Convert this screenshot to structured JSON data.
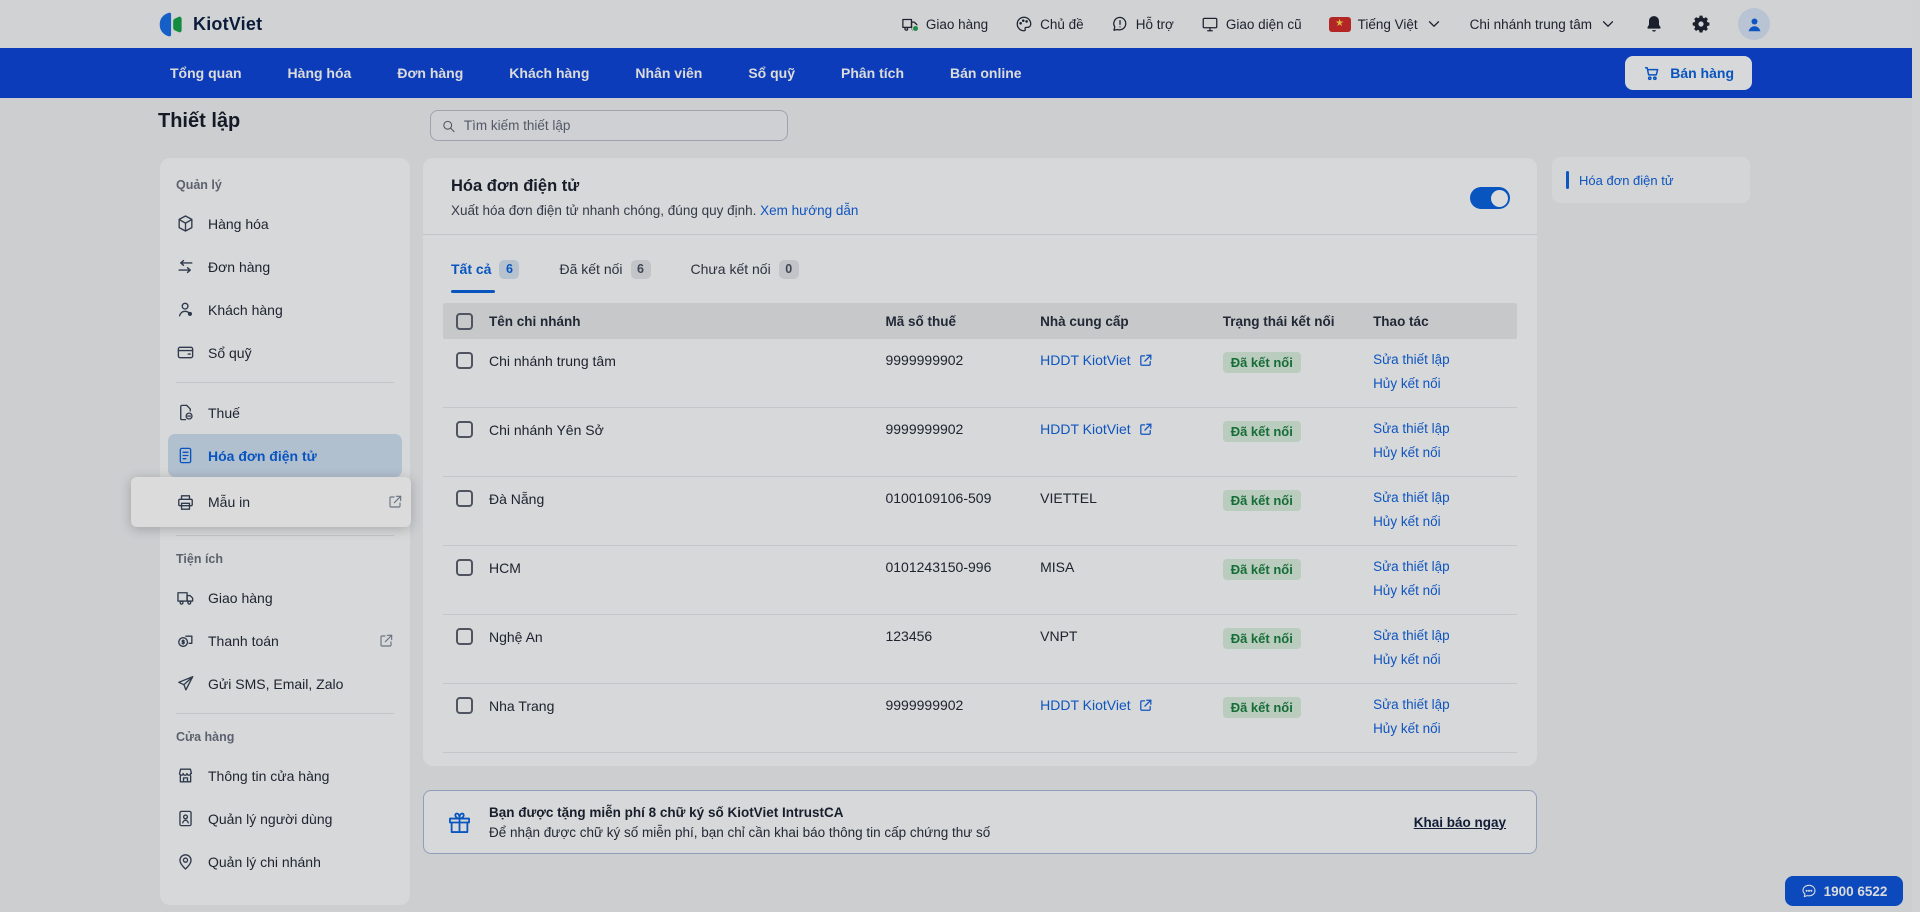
{
  "colors": {
    "accent_blue": "#0b63e0",
    "nav_blue": "#0f46d8",
    "success_green": "#1a7f42",
    "chat_blue": "#0d55dd"
  },
  "topbar": {
    "brand": "KiotViet",
    "menu": [
      {
        "icon": "truck",
        "label": "Giao hàng",
        "dot": true
      },
      {
        "icon": "palette",
        "label": "Chủ đề"
      },
      {
        "icon": "help",
        "label": "Hỗ trợ"
      },
      {
        "icon": "monitor",
        "label": "Giao diện cũ"
      }
    ],
    "language": "Tiếng Việt",
    "flag_star": "★",
    "branch": "Chi nhánh trung tâm"
  },
  "nav": {
    "items": [
      {
        "label": "Tổng quan"
      },
      {
        "label": "Hàng hóa"
      },
      {
        "label": "Đơn hàng"
      },
      {
        "label": "Khách hàng"
      },
      {
        "label": "Nhân viên"
      },
      {
        "label": "Sổ quỹ"
      },
      {
        "label": "Phân tích"
      },
      {
        "label": "Bán online"
      }
    ],
    "sell_button": "Bán hàng"
  },
  "page": {
    "title": "Thiết lập",
    "search_placeholder": "Tìm kiếm thiết lập"
  },
  "sidebar": {
    "groups": [
      {
        "label": "Quản lý",
        "items": [
          {
            "icon": "cube",
            "label": "Hàng hóa"
          },
          {
            "icon": "swap",
            "label": "Đơn hàng"
          },
          {
            "icon": "user",
            "label": "Khách hàng"
          },
          {
            "icon": "wallet",
            "label": "Sổ quỹ",
            "divider_after": true
          },
          {
            "icon": "tax",
            "label": "Thuế"
          },
          {
            "icon": "invoice",
            "label": "Hóa đơn điện tử",
            "selected": true
          },
          {
            "icon": "printer",
            "label": "Mẫu in",
            "spotlight": true,
            "external": true
          }
        ]
      },
      {
        "label": "Tiện ích",
        "divider_top": true,
        "items": [
          {
            "icon": "truck",
            "label": "Giao hàng"
          },
          {
            "icon": "coin",
            "label": "Thanh toán",
            "external": true
          },
          {
            "icon": "send",
            "label": "Gửi SMS, Email, Zalo"
          }
        ]
      },
      {
        "label": "Cửa hàng",
        "divider_top": true,
        "items": [
          {
            "icon": "store",
            "label": "Thông tin cửa hàng"
          },
          {
            "icon": "idcard",
            "label": "Quản lý người dùng"
          },
          {
            "icon": "pin",
            "label": "Quản lý chi nhánh"
          }
        ]
      }
    ]
  },
  "main": {
    "title": "Hóa đơn điện tử",
    "subtitle": "Xuất hóa đơn điện tử nhanh chóng, đúng quy định.",
    "guide_link": "Xem hướng dẫn",
    "toggle_on": true,
    "tabs": [
      {
        "label": "Tất cả",
        "count": "6",
        "active": true
      },
      {
        "label": "Đã kết nối",
        "count": "6"
      },
      {
        "label": "Chưa kết nối",
        "count": "0"
      }
    ],
    "table": {
      "headers": [
        "Tên chi nhánh",
        "Mã số thuế",
        "Nhà cung cấp",
        "Trạng thái kết nối",
        "Thao tác"
      ],
      "action_edit": "Sửa thiết lập",
      "action_cancel": "Hủy kết nối",
      "rows": [
        {
          "name": "Chi nhánh trung tâm",
          "tax_code": "9999999902",
          "provider": "HDDT KiotViet",
          "provider_link": true,
          "status": "Đã kết nối"
        },
        {
          "name": "Chi nhánh Yên Sở",
          "tax_code": "9999999902",
          "provider": "HDDT KiotViet",
          "provider_link": true,
          "status": "Đã kết nối"
        },
        {
          "name": "Đà Nẵng",
          "tax_code": "0100109106-509",
          "provider": "VIETTEL",
          "status": "Đã kết nối"
        },
        {
          "name": "HCM",
          "tax_code": "0101243150-996",
          "provider": "MISA",
          "status": "Đã kết nối"
        },
        {
          "name": "Nghệ An",
          "tax_code": "123456",
          "provider": "VNPT",
          "status": "Đã kết nối"
        },
        {
          "name": "Nha Trang",
          "tax_code": "9999999902",
          "provider": "HDDT KiotViet",
          "provider_link": true,
          "status": "Đã kết nối"
        }
      ]
    }
  },
  "banner": {
    "title": "Bạn được tặng miễn phí 8 chữ ký số KiotViet IntrustCA",
    "subtitle": "Để nhận được chữ ký số miễn phí, bạn chỉ cần khai báo thông tin cấp chứng thư số",
    "cta": "Khai báo ngay"
  },
  "anchor": {
    "label": "Hóa đơn điện tử"
  },
  "chat": {
    "phone": "1900 6522"
  }
}
